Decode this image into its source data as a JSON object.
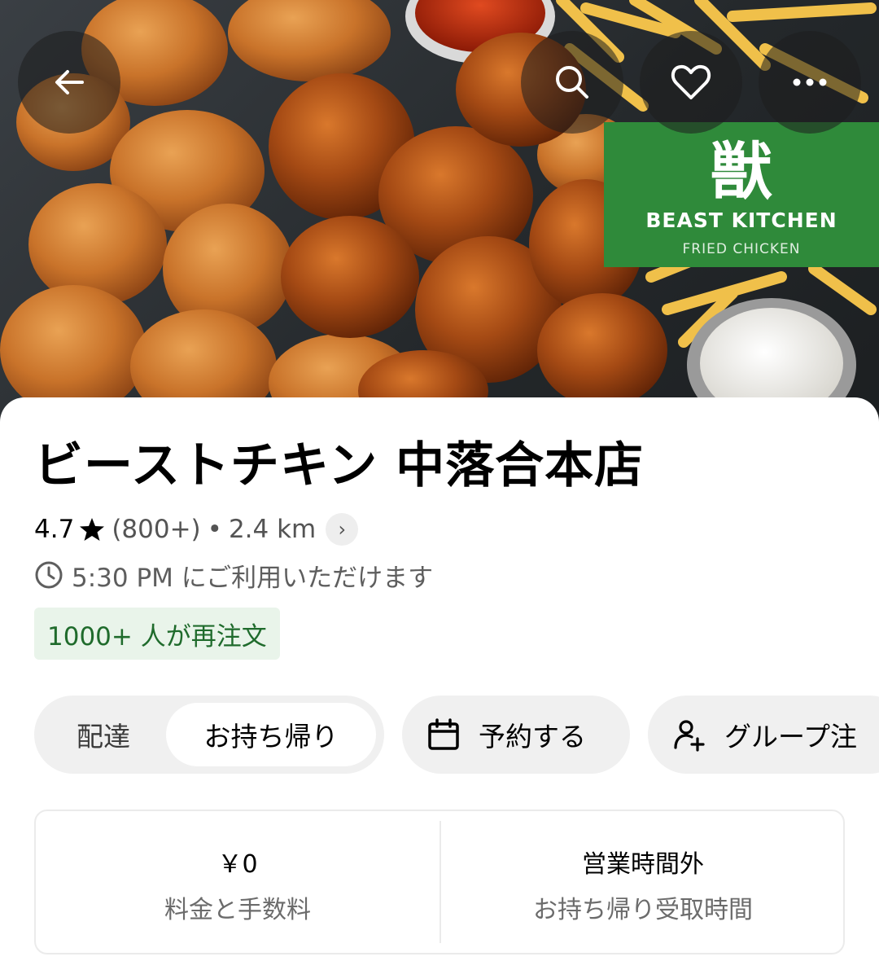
{
  "hero": {
    "brand": {
      "mark": "獣",
      "name": "BEAST KITCHEN",
      "subtitle": "FRIED CHICKEN",
      "color": "#2f8a3a"
    },
    "icons": [
      "back-arrow-icon",
      "search-icon",
      "heart-icon",
      "more-icon"
    ]
  },
  "store": {
    "name": "ビーストチキン 中落合本店",
    "rating": "4.7",
    "reviews": "(800+)",
    "separator": "•",
    "distance": "2.4 km",
    "chevron": "›",
    "availability": "5:30 PM にご利用いただけます",
    "reorder_badge": "1000+ 人が再注文",
    "accent_green": "#1f6b2c"
  },
  "actions": {
    "mode_delivery": "配達",
    "mode_pickup": "お持ち帰り",
    "reserve": "予約する",
    "group_order": "グループ注"
  },
  "info": {
    "fee_value": "￥0",
    "fee_label": "料金と手数料",
    "status_value": "営業時間外",
    "status_label": "お持ち帰り受取時間"
  }
}
